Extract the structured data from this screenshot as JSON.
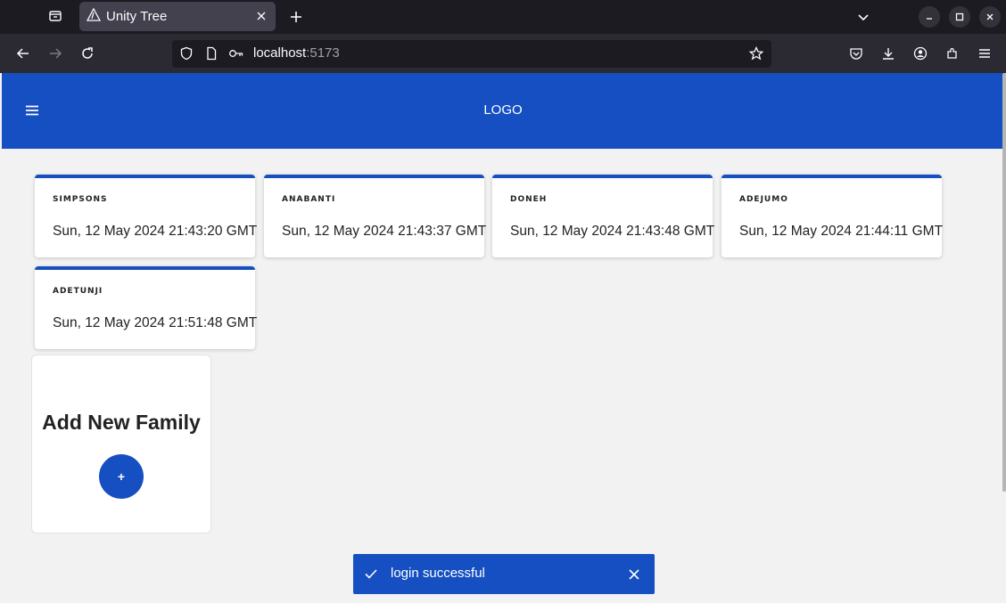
{
  "browser": {
    "tab_title": "Unity Tree",
    "url_host": "localhost",
    "url_port": ":5173"
  },
  "app": {
    "logo": "LOGO"
  },
  "families": [
    {
      "name": "SIMPSONS",
      "date": "Sun, 12 May 2024 21:43:20 GMT"
    },
    {
      "name": "ANABANTI",
      "date": "Sun, 12 May 2024 21:43:37 GMT"
    },
    {
      "name": "DONEH",
      "date": "Sun, 12 May 2024 21:43:48 GMT"
    },
    {
      "name": "ADEJUMO",
      "date": "Sun, 12 May 2024 21:44:11 GMT"
    },
    {
      "name": "ADETUNJI",
      "date": "Sun, 12 May 2024 21:51:48 GMT"
    }
  ],
  "add_family": {
    "title": "Add New Family",
    "button_label": "+"
  },
  "toast": {
    "message": "login successful"
  },
  "colors": {
    "primary": "#154fc1",
    "page_bg": "#f2f2f2",
    "chrome_dark": "#1c1b22"
  }
}
